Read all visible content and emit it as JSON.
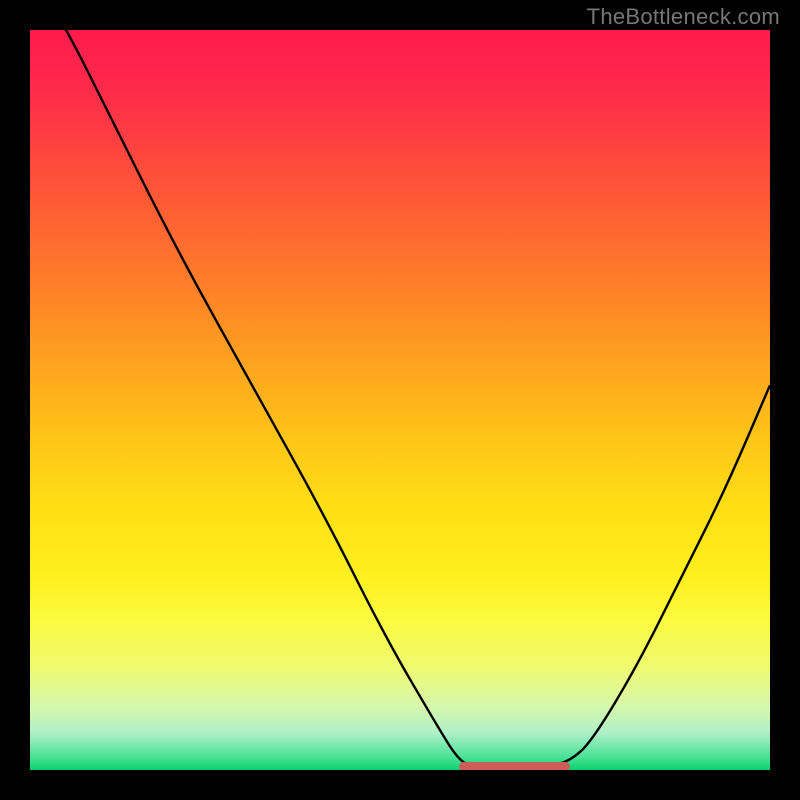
{
  "attribution": "TheBottleneck.com",
  "chart_data": {
    "type": "line",
    "title": "",
    "xlabel": "",
    "ylabel": "",
    "xlim": [
      0,
      100
    ],
    "ylim": [
      0,
      100
    ],
    "curve": [
      {
        "x": 0,
        "y": 108
      },
      {
        "x": 5,
        "y": 100
      },
      {
        "x": 10,
        "y": 90
      },
      {
        "x": 20,
        "y": 70
      },
      {
        "x": 30,
        "y": 52
      },
      {
        "x": 40,
        "y": 34
      },
      {
        "x": 48,
        "y": 18
      },
      {
        "x": 55,
        "y": 6
      },
      {
        "x": 58,
        "y": 1.2
      },
      {
        "x": 60,
        "y": 0.5
      },
      {
        "x": 65,
        "y": 0.5
      },
      {
        "x": 70,
        "y": 0.5
      },
      {
        "x": 73,
        "y": 1.2
      },
      {
        "x": 76,
        "y": 4
      },
      {
        "x": 82,
        "y": 14
      },
      {
        "x": 88,
        "y": 26
      },
      {
        "x": 94,
        "y": 38
      },
      {
        "x": 100,
        "y": 52
      }
    ],
    "flat_segment": {
      "x_start": 58,
      "x_end": 73,
      "y": 0.5
    },
    "gradient_stops": [
      {
        "pct": 0,
        "color": "#ff1a4d"
      },
      {
        "pct": 50,
        "color": "#ffb018"
      },
      {
        "pct": 80,
        "color": "#fff530"
      },
      {
        "pct": 100,
        "color": "#0ad070"
      }
    ]
  }
}
